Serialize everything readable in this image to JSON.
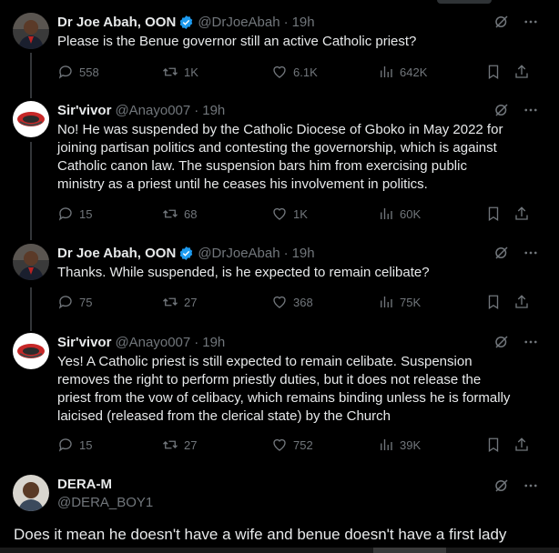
{
  "tweets": [
    {
      "author": "Dr Joe Abah, OON",
      "verified": true,
      "handle": "@DrJoeAbah",
      "time": "19h",
      "text": "Please is the Benue governor still an active Catholic priest?",
      "replies": "558",
      "retweets": "1K",
      "likes": "6.1K",
      "views": "642K"
    },
    {
      "author": "Sir'vivor",
      "verified": false,
      "handle": "@Anayo007",
      "time": "19h",
      "text": "No! He was suspended by the Catholic Diocese of Gboko in May 2022 for\njoining partisan politics and contesting the governorship, which is against\nCatholic canon law. The suspension bars him from exercising public\nministry as a priest until he ceases his involvement in politics.",
      "replies": "15",
      "retweets": "68",
      "likes": "1K",
      "views": "60K"
    },
    {
      "author": "Dr Joe Abah, OON",
      "verified": true,
      "handle": "@DrJoeAbah",
      "time": "19h",
      "text": "Thanks. While suspended, is he expected to remain celibate?",
      "replies": "75",
      "retweets": "27",
      "likes": "368",
      "views": "75K"
    },
    {
      "author": "Sir'vivor",
      "verified": false,
      "handle": "@Anayo007",
      "time": "19h",
      "text": "Yes! A Catholic priest is still expected to remain celibate. Suspension\nremoves the right to perform priestly duties, but it does not release the\npriest from the vow of celibacy, which remains binding unless he is formally\nlaicised (released from the clerical state) by the Church",
      "replies": "15",
      "retweets": "27",
      "likes": "752",
      "views": "39K"
    }
  ],
  "reply": {
    "author": "DERA-M",
    "handle": "@DERA_BOY1",
    "text": "Does it mean he doesn't have a wife and benue doesn't have a first lady"
  },
  "colors": {
    "background": "#000000",
    "text": "#e7e9ea",
    "muted": "#71767b",
    "verified": "#1d9bf0",
    "thread_line": "#333639"
  },
  "icons": [
    "grok-icon",
    "more-icon",
    "reply-icon",
    "retweet-icon",
    "like-icon",
    "views-icon",
    "bookmark-icon",
    "share-icon",
    "verified-badge-icon"
  ]
}
